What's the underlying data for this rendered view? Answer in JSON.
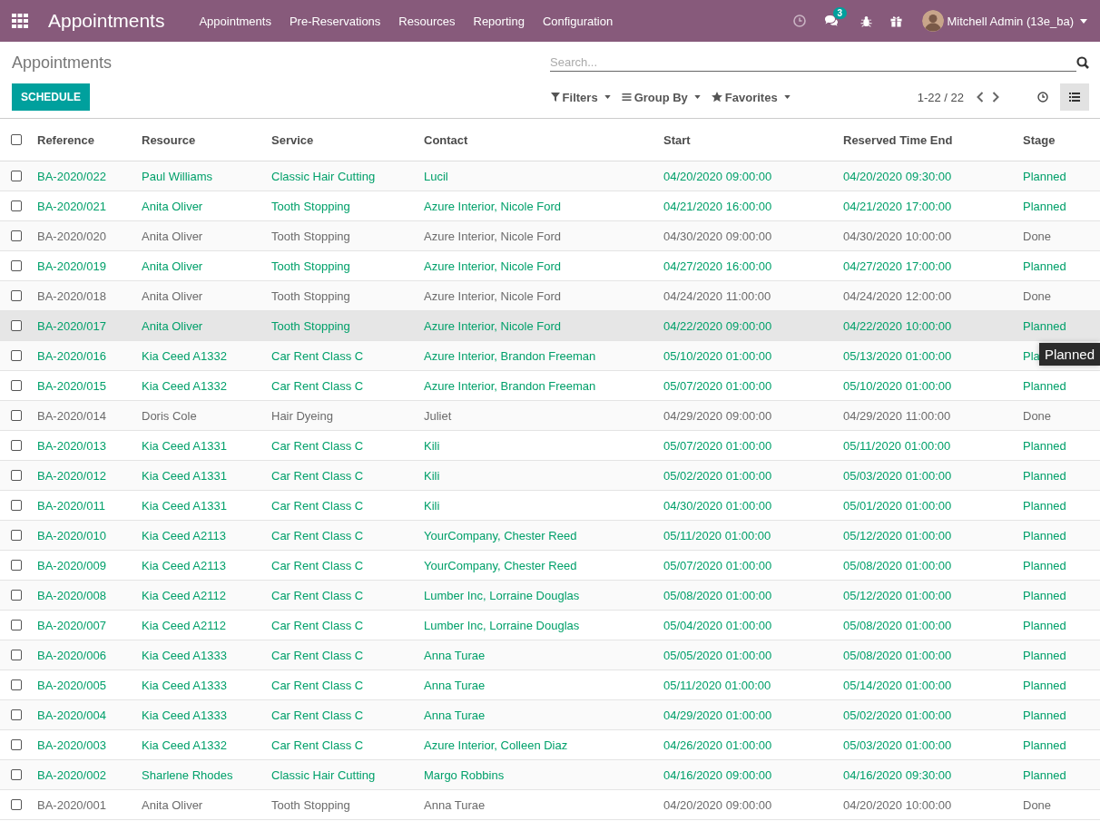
{
  "navbar": {
    "app_title": "Appointments",
    "menu": [
      "Appointments",
      "Pre-Reservations",
      "Resources",
      "Reporting",
      "Configuration"
    ],
    "chat_badge": "3",
    "user": "Mitchell Admin (13e_ba)"
  },
  "control_panel": {
    "breadcrumb": "Appointments",
    "search": {
      "placeholder": "Search..."
    },
    "schedule_button": "SCHEDULE",
    "filters": [
      "Filters",
      "Group By",
      "Favorites"
    ],
    "pager": "1-22 / 22",
    "views": [
      {
        "kind": "activity",
        "selected": false
      },
      {
        "kind": "list",
        "selected": true
      }
    ]
  },
  "table": {
    "select_all_checked": false,
    "columns": [
      "Reference",
      "Resource",
      "Service",
      "Contact",
      "Start",
      "Reserved Time End",
      "Stage"
    ],
    "rows": [
      {
        "kind": "planned",
        "hovered": false,
        "checked": false,
        "cells": [
          "BA-2020/022",
          "Paul Williams",
          "Classic Hair Cutting",
          "Lucil",
          "04/20/2020 09:00:00",
          "04/20/2020 09:30:00",
          "Planned"
        ]
      },
      {
        "kind": "planned",
        "hovered": false,
        "checked": false,
        "cells": [
          "BA-2020/021",
          "Anita Oliver",
          "Tooth Stopping",
          "Azure Interior, Nicole Ford",
          "04/21/2020 16:00:00",
          "04/21/2020 17:00:00",
          "Planned"
        ]
      },
      {
        "kind": "done",
        "hovered": false,
        "checked": false,
        "cells": [
          "BA-2020/020",
          "Anita Oliver",
          "Tooth Stopping",
          "Azure Interior, Nicole Ford",
          "04/30/2020 09:00:00",
          "04/30/2020 10:00:00",
          "Done"
        ]
      },
      {
        "kind": "planned",
        "hovered": false,
        "checked": false,
        "cells": [
          "BA-2020/019",
          "Anita Oliver",
          "Tooth Stopping",
          "Azure Interior, Nicole Ford",
          "04/27/2020 16:00:00",
          "04/27/2020 17:00:00",
          "Planned"
        ]
      },
      {
        "kind": "done",
        "hovered": false,
        "checked": false,
        "cells": [
          "BA-2020/018",
          "Anita Oliver",
          "Tooth Stopping",
          "Azure Interior, Nicole Ford",
          "04/24/2020 11:00:00",
          "04/24/2020 12:00:00",
          "Done"
        ]
      },
      {
        "kind": "planned",
        "hovered": true,
        "checked": false,
        "cells": [
          "BA-2020/017",
          "Anita Oliver",
          "Tooth Stopping",
          "Azure Interior, Nicole Ford",
          "04/22/2020 09:00:00",
          "04/22/2020 10:00:00",
          "Planned"
        ]
      },
      {
        "kind": "planned",
        "hovered": false,
        "checked": false,
        "cells": [
          "BA-2020/016",
          "Kia Ceed A1332",
          "Car Rent Class C",
          "Azure Interior, Brandon Freeman",
          "05/10/2020 01:00:00",
          "05/13/2020 01:00:00",
          "Pla"
        ],
        "tooltip": "Planned"
      },
      {
        "kind": "planned",
        "hovered": false,
        "checked": false,
        "cells": [
          "BA-2020/015",
          "Kia Ceed A1332",
          "Car Rent Class C",
          "Azure Interior, Brandon Freeman",
          "05/07/2020 01:00:00",
          "05/10/2020 01:00:00",
          "Planned"
        ]
      },
      {
        "kind": "done",
        "hovered": false,
        "checked": false,
        "cells": [
          "BA-2020/014",
          "Doris Cole",
          "Hair Dyeing",
          "Juliet",
          "04/29/2020 09:00:00",
          "04/29/2020 11:00:00",
          "Done"
        ]
      },
      {
        "kind": "planned",
        "hovered": false,
        "checked": false,
        "cells": [
          "BA-2020/013",
          "Kia Ceed A1331",
          "Car Rent Class C",
          "Kili",
          "05/07/2020 01:00:00",
          "05/11/2020 01:00:00",
          "Planned"
        ]
      },
      {
        "kind": "planned",
        "hovered": false,
        "checked": false,
        "cells": [
          "BA-2020/012",
          "Kia Ceed A1331",
          "Car Rent Class C",
          "Kili",
          "05/02/2020 01:00:00",
          "05/03/2020 01:00:00",
          "Planned"
        ]
      },
      {
        "kind": "planned",
        "hovered": false,
        "checked": false,
        "cells": [
          "BA-2020/011",
          "Kia Ceed A1331",
          "Car Rent Class C",
          "Kili",
          "04/30/2020 01:00:00",
          "05/01/2020 01:00:00",
          "Planned"
        ]
      },
      {
        "kind": "planned",
        "hovered": false,
        "checked": false,
        "cells": [
          "BA-2020/010",
          "Kia Ceed A2113",
          "Car Rent Class C",
          "YourCompany, Chester Reed",
          "05/11/2020 01:00:00",
          "05/12/2020 01:00:00",
          "Planned"
        ]
      },
      {
        "kind": "planned",
        "hovered": false,
        "checked": false,
        "cells": [
          "BA-2020/009",
          "Kia Ceed A2113",
          "Car Rent Class C",
          "YourCompany, Chester Reed",
          "05/07/2020 01:00:00",
          "05/08/2020 01:00:00",
          "Planned"
        ]
      },
      {
        "kind": "planned",
        "hovered": false,
        "checked": false,
        "cells": [
          "BA-2020/008",
          "Kia Ceed A2112",
          "Car Rent Class C",
          "Lumber Inc, Lorraine Douglas",
          "05/08/2020 01:00:00",
          "05/12/2020 01:00:00",
          "Planned"
        ]
      },
      {
        "kind": "planned",
        "hovered": false,
        "checked": false,
        "cells": [
          "BA-2020/007",
          "Kia Ceed A2112",
          "Car Rent Class C",
          "Lumber Inc, Lorraine Douglas",
          "05/04/2020 01:00:00",
          "05/08/2020 01:00:00",
          "Planned"
        ]
      },
      {
        "kind": "planned",
        "hovered": false,
        "checked": false,
        "cells": [
          "BA-2020/006",
          "Kia Ceed A1333",
          "Car Rent Class C",
          "Anna Turae",
          "05/05/2020 01:00:00",
          "05/08/2020 01:00:00",
          "Planned"
        ]
      },
      {
        "kind": "planned",
        "hovered": false,
        "checked": false,
        "cells": [
          "BA-2020/005",
          "Kia Ceed A1333",
          "Car Rent Class C",
          "Anna Turae",
          "05/11/2020 01:00:00",
          "05/14/2020 01:00:00",
          "Planned"
        ]
      },
      {
        "kind": "planned",
        "hovered": false,
        "checked": false,
        "cells": [
          "BA-2020/004",
          "Kia Ceed A1333",
          "Car Rent Class C",
          "Anna Turae",
          "04/29/2020 01:00:00",
          "05/02/2020 01:00:00",
          "Planned"
        ]
      },
      {
        "kind": "planned",
        "hovered": false,
        "checked": false,
        "cells": [
          "BA-2020/003",
          "Kia Ceed A1332",
          "Car Rent Class C",
          "Azure Interior, Colleen Diaz",
          "04/26/2020 01:00:00",
          "05/03/2020 01:00:00",
          "Planned"
        ]
      },
      {
        "kind": "planned",
        "hovered": false,
        "checked": false,
        "cells": [
          "BA-2020/002",
          "Sharlene Rhodes",
          "Classic Hair Cutting",
          "Margo Robbins",
          "04/16/2020 09:00:00",
          "04/16/2020 09:30:00",
          "Planned"
        ]
      },
      {
        "kind": "done",
        "hovered": false,
        "checked": false,
        "cells": [
          "BA-2020/001",
          "Anita Oliver",
          "Tooth Stopping",
          "Anna Turae",
          "04/20/2020 09:00:00",
          "04/20/2020 10:00:00",
          "Done"
        ]
      }
    ]
  }
}
